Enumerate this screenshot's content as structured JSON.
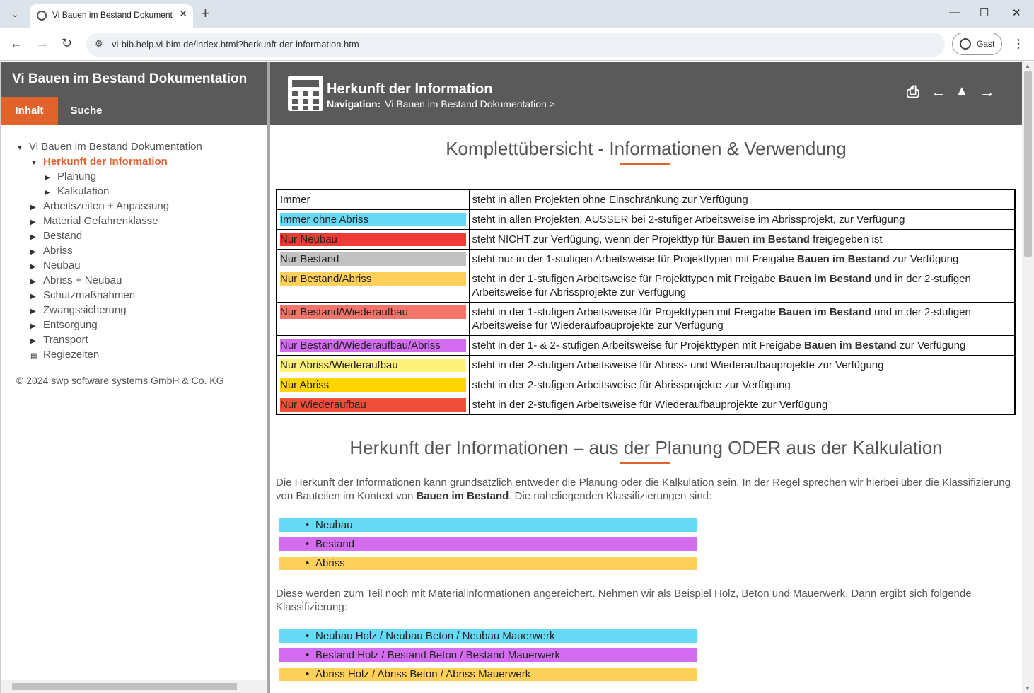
{
  "browser": {
    "tab_title": "Vi Bauen im Bestand Dokumentation",
    "new_tab": "+",
    "url": "vi-bib.help.vi-bim.de/index.html?herkunft-der-information.htm",
    "profile_label": "Gast",
    "window_controls": {
      "minimize": "—",
      "maximize": "☐",
      "close": "✕"
    },
    "nav": {
      "back": "←",
      "forward": "→",
      "reload": "↻"
    }
  },
  "sidebar": {
    "title": "Vi Bauen im Bestand Dokumentation",
    "tabs": {
      "contents": "Inhalt",
      "search": "Suche"
    },
    "tree": [
      {
        "label": "Vi Bauen im Bestand Dokumentation",
        "toggle": "▼"
      },
      {
        "label": "Herkunft der Information",
        "toggle": "▼"
      },
      {
        "label": "Planung",
        "toggle": "▶"
      },
      {
        "label": "Kalkulation",
        "toggle": "▶"
      },
      {
        "label": "Arbeitszeiten + Anpassung",
        "toggle": "▶"
      },
      {
        "label": "Material Gefahrenklasse",
        "toggle": "▶"
      },
      {
        "label": "Bestand",
        "toggle": "▶"
      },
      {
        "label": "Abriss",
        "toggle": "▶"
      },
      {
        "label": "Neubau",
        "toggle": "▶"
      },
      {
        "label": "Abriss + Neubau",
        "toggle": "▶"
      },
      {
        "label": "Schutzmaßnahmen",
        "toggle": "▶"
      },
      {
        "label": "Zwangssicherung",
        "toggle": "▶"
      },
      {
        "label": "Entsorgung",
        "toggle": "▶"
      },
      {
        "label": "Transport",
        "toggle": "▶"
      },
      {
        "label": "Regiezeiten",
        "toggle": "▤"
      }
    ],
    "copyright": "© 2024 swp software systems GmbH & Co. KG"
  },
  "content": {
    "title": "Herkunft der Information",
    "nav_label": "Navigation:",
    "nav_path": "Vi Bauen im Bestand Dokumentation >",
    "heading1": "Komplettübersicht - Informationen & Verwendung",
    "legend": [
      {
        "label": "Immer",
        "color": "",
        "text_color": "#222222",
        "desc_parts": [
          "steht in allen Projekten ohne Einschränkung zur Verfügung"
        ]
      },
      {
        "label": "Immer ohne Abriss",
        "color": "#66d9f5",
        "text_color": "#222222",
        "desc_parts": [
          "steht in allen Projekten, AUSSER bei 2-stufiger Arbeitsweise im Abrissprojekt, zur Verfügung"
        ]
      },
      {
        "label": "Nur Neubau",
        "color": "#f03a36",
        "text_color": "#222222",
        "desc_parts": [
          "steht NICHT zur Verfügung, wenn der Projekttyp für ",
          "Bauen im Bestand",
          " freigegeben ist"
        ]
      },
      {
        "label": "Nur Bestand",
        "color": "#c2c2c2",
        "text_color": "#222222",
        "desc_parts": [
          "steht nur in der 1-stufigen Arbeitsweise für Projekttypen mit Freigabe ",
          "Bauen im Bestand",
          " zur Verfügung"
        ]
      },
      {
        "label": "Nur Bestand/Abriss",
        "color": "#ffd05a",
        "text_color": "#222222",
        "desc_parts": [
          "steht in der 1-stufigen Arbeitsweise für Projekttypen mit Freigabe ",
          "Bauen im Bestand",
          " und in der 2-stufigen Arbeitsweise für Abrissprojekte zur Verfügung"
        ]
      },
      {
        "label": "Nur Bestand/Wiederaufbau",
        "color": "#f5756a",
        "text_color": "#222222",
        "desc_parts": [
          "steht in der 1-stufigen Arbeitsweise für Projekttypen mit Freigabe ",
          "Bauen im Bestand",
          " und in der 2-stufigen Arbeitsweise für Wiederaufbauprojekte zur Verfügung"
        ]
      },
      {
        "label": "Nur Bestand/Wiederaufbau/Abriss",
        "color": "#d36cf0",
        "text_color": "#222222",
        "desc_parts": [
          "steht in der 1- & 2- stufigen Arbeitsweise für Projekttypen mit Freigabe ",
          "Bauen im Bestand",
          " zur Verfügung"
        ]
      },
      {
        "label": "Nur Abriss/Wiederaufbau",
        "color": "#fff27a",
        "text_color": "#222222",
        "desc_parts": [
          "steht in der 2-stufigen Arbeitsweise für Abriss- und Wiederaufbauprojekte zur Verfügung"
        ]
      },
      {
        "label": "Nur Abriss",
        "color": "#ffd500",
        "text_color": "#222222",
        "desc_parts": [
          "steht in der 2-stufigen Arbeitsweise für Abrissprojekte zur Verfügung"
        ]
      },
      {
        "label": "Nur Wiederaufbau",
        "color": "#f0503a",
        "text_color": "#222222",
        "desc_parts": [
          "steht in der 2-stufigen Arbeitsweise für Wiederaufbauprojekte zur Verfügung"
        ]
      }
    ],
    "heading2": "Herkunft der Informationen – aus der Planung ODER aus der Kalkulation",
    "para1_a": "Die Herkunft der Informationen kann grundsätzlich entweder die Planung oder die Kalkulation sein. In der Regel sprechen wir hierbei über die Klassifizierung von Bauteilen im Kontext von ",
    "para1_b": "Bauen im Bestand",
    "para1_c": ". Die naheliegenden Klassifizierungen sind:",
    "classes1": [
      {
        "label": "Neubau",
        "color": "#66d9f5"
      },
      {
        "label": "Bestand",
        "color": "#d36cf0"
      },
      {
        "label": "Abriss",
        "color": "#ffd05a"
      }
    ],
    "para2": "Diese werden zum Teil noch mit Materialinformationen angereichert. Nehmen wir als Beispiel Holz, Beton und Mauerwerk. Dann ergibt sich folgende Klassifizierung:",
    "classes2": [
      {
        "label": "Neubau Holz / Neubau Beton / Neubau Mauerwerk",
        "color": "#66d9f5"
      },
      {
        "label": "Bestand Holz / Bestand Beton / Bestand Mauerwerk",
        "color": "#d36cf0"
      },
      {
        "label": "Abriss Holz / Abriss Beton / Abriss Mauerwerk",
        "color": "#ffd05a"
      }
    ],
    "bullet": "•",
    "accent_color": "#e2622c"
  }
}
